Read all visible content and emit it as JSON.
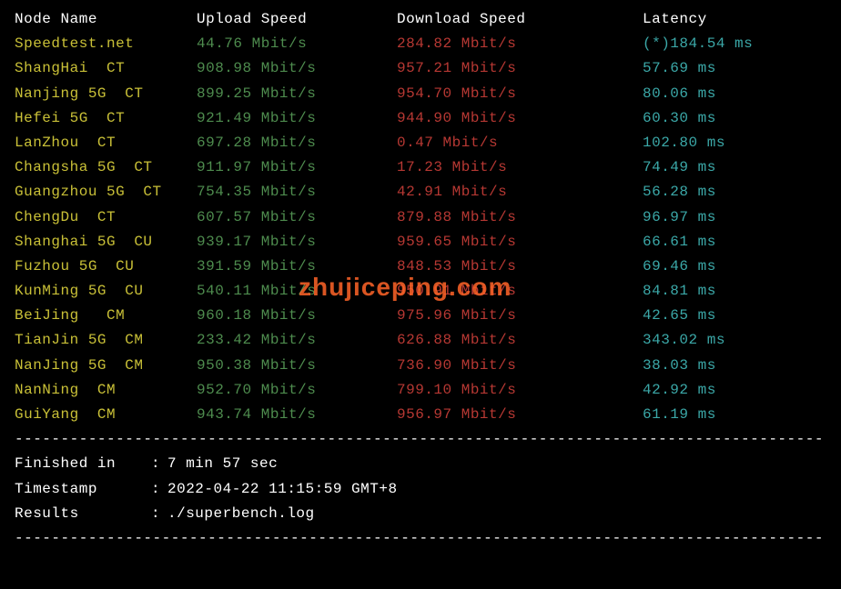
{
  "headers": {
    "node": "Node Name",
    "upload": "Upload Speed",
    "download": "Download Speed",
    "latency": "Latency"
  },
  "rows": [
    {
      "node": "Speedtest.net",
      "upload": "44.76 Mbit/s",
      "download": "284.82 Mbit/s",
      "latency": "(*)184.54 ms"
    },
    {
      "node": "ShangHai  CT",
      "upload": "908.98 Mbit/s",
      "download": "957.21 Mbit/s",
      "latency": "57.69 ms"
    },
    {
      "node": "Nanjing 5G  CT",
      "upload": "899.25 Mbit/s",
      "download": "954.70 Mbit/s",
      "latency": "80.06 ms"
    },
    {
      "node": "Hefei 5G  CT",
      "upload": "921.49 Mbit/s",
      "download": "944.90 Mbit/s",
      "latency": "60.30 ms"
    },
    {
      "node": "LanZhou  CT",
      "upload": "697.28 Mbit/s",
      "download": "0.47 Mbit/s",
      "latency": "102.80 ms"
    },
    {
      "node": "Changsha 5G  CT",
      "upload": "911.97 Mbit/s",
      "download": "17.23 Mbit/s",
      "latency": "74.49 ms"
    },
    {
      "node": "Guangzhou 5G  CT",
      "upload": "754.35 Mbit/s",
      "download": "42.91 Mbit/s",
      "latency": "56.28 ms"
    },
    {
      "node": "ChengDu  CT",
      "upload": "607.57 Mbit/s",
      "download": "879.88 Mbit/s",
      "latency": "96.97 ms"
    },
    {
      "node": "Shanghai 5G  CU",
      "upload": "939.17 Mbit/s",
      "download": "959.65 Mbit/s",
      "latency": "66.61 ms"
    },
    {
      "node": "Fuzhou 5G  CU",
      "upload": "391.59 Mbit/s",
      "download": "848.53 Mbit/s",
      "latency": "69.46 ms"
    },
    {
      "node": "KunMing 5G  CU",
      "upload": "540.11 Mbit/s",
      "download": "950.91 Mbit/s",
      "latency": "84.81 ms"
    },
    {
      "node": "BeiJing   CM",
      "upload": "960.18 Mbit/s",
      "download": "975.96 Mbit/s",
      "latency": "42.65 ms"
    },
    {
      "node": "TianJin 5G  CM",
      "upload": "233.42 Mbit/s",
      "download": "626.88 Mbit/s",
      "latency": "343.02 ms"
    },
    {
      "node": "NanJing 5G  CM",
      "upload": "950.38 Mbit/s",
      "download": "736.90 Mbit/s",
      "latency": "38.03 ms"
    },
    {
      "node": "NanNing  CM",
      "upload": "952.70 Mbit/s",
      "download": "799.10 Mbit/s",
      "latency": "42.92 ms"
    },
    {
      "node": "GuiYang  CM",
      "upload": "943.74 Mbit/s",
      "download": "956.97 Mbit/s",
      "latency": "61.19 ms"
    }
  ],
  "divider": "----------------------------------------------------------------------------------------",
  "footer": {
    "finished_label": "Finished in",
    "finished_value": "7 min 57 sec",
    "timestamp_label": "Timestamp",
    "timestamp_value": "2022-04-22 11:15:59 GMT+8",
    "results_label": "Results",
    "results_value": "./superbench.log"
  },
  "watermark": "zhujiceping.com"
}
